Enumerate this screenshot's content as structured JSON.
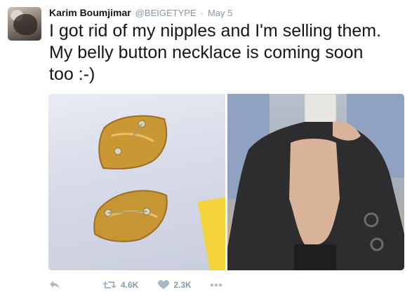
{
  "tweet": {
    "display_name": "Karim Boumjimar",
    "handle": "@BEIGETYPE",
    "separator": "·",
    "date": "May 5",
    "text": "I got rid of my nipples and I'm selling them.\nMy belly button necklace is coming soon\ntoo :-)"
  },
  "actions": {
    "retweet_count": "4.6K",
    "like_count": "2.3K"
  },
  "icons": {
    "reply": "reply-icon",
    "retweet": "retweet-icon",
    "like": "heart-icon",
    "more": "more-dots-icon"
  },
  "colors": {
    "text": "#14171a",
    "muted": "#8899a6"
  }
}
